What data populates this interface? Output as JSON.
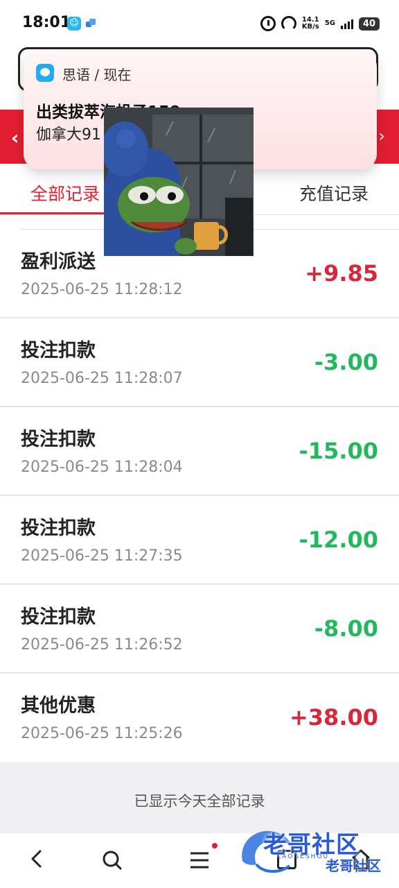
{
  "status_bar": {
    "time": "18:01",
    "speed": "14.1",
    "speed_unit": "KB/s",
    "network": "5G",
    "battery": "40"
  },
  "notification": {
    "app_name": "思语",
    "when": "现在",
    "separator": "/",
    "title": "出类拔萃海帆子159",
    "body": "伽拿大91"
  },
  "tabs": {
    "all": "全部记录",
    "recharge": "充值记录"
  },
  "records": [
    {
      "title": "盈利派送",
      "time": "2025-06-25 11:28:12",
      "amount": "+9.85",
      "type": "pos"
    },
    {
      "title": "投注扣款",
      "time": "2025-06-25 11:28:07",
      "amount": "-3.00",
      "type": "neg"
    },
    {
      "title": "投注扣款",
      "time": "2025-06-25 11:28:04",
      "amount": "-15.00",
      "type": "neg"
    },
    {
      "title": "投注扣款",
      "time": "2025-06-25 11:27:35",
      "amount": "-12.00",
      "type": "neg"
    },
    {
      "title": "投注扣款",
      "time": "2025-06-25 11:26:52",
      "amount": "-8.00",
      "type": "neg"
    },
    {
      "title": "其他优惠",
      "time": "2025-06-25 11:25:26",
      "amount": "+38.00",
      "type": "pos"
    }
  ],
  "footer_note": "已显示今天全部记录",
  "watermark": {
    "text": "老哥社区",
    "sub": "LAOGESHOU"
  },
  "colors": {
    "accent_red": "#e21f32",
    "positive": "#d9263a",
    "negative": "#22b85c"
  }
}
